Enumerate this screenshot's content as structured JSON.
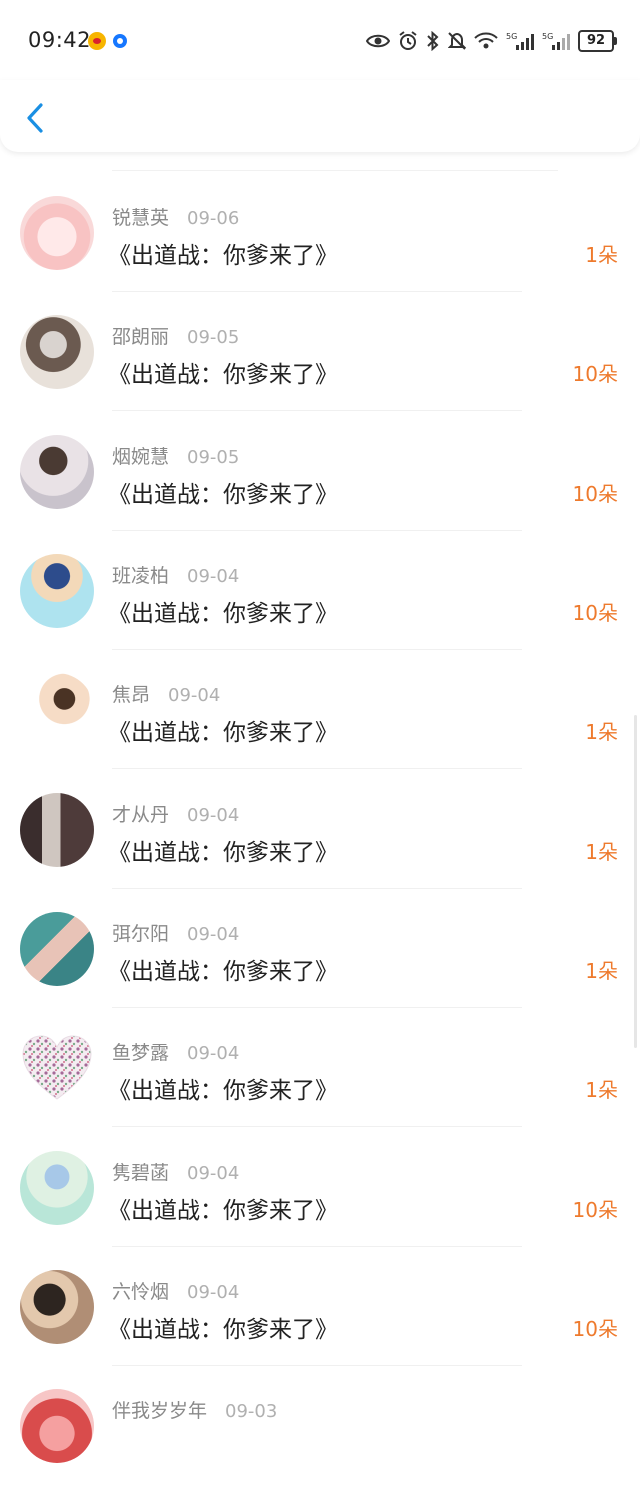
{
  "status_bar": {
    "time": "09:42",
    "battery": "92",
    "icons": [
      "weibo-icon",
      "app-notification-icon",
      "eye-icon",
      "alarm-icon",
      "bluetooth-icon",
      "mute-icon",
      "wifi-icon",
      "signal-5g-icon",
      "signal-5g-icon"
    ]
  },
  "header": {
    "back_icon": "chevron-left-icon"
  },
  "colors": {
    "accent": "#1a8fe3",
    "gift": "#ee7a2d",
    "name": "#8a8a8a",
    "date": "#b0b0b0"
  },
  "records": [
    {
      "name": "锐慧英",
      "date": "09-06",
      "title": "《出道战：你爹来了》",
      "gift": "1朵"
    },
    {
      "name": "邵朗丽",
      "date": "09-05",
      "title": "《出道战：你爹来了》",
      "gift": "10朵"
    },
    {
      "name": "烟婉慧",
      "date": "09-05",
      "title": "《出道战：你爹来了》",
      "gift": "10朵"
    },
    {
      "name": "班凌柏",
      "date": "09-04",
      "title": "《出道战：你爹来了》",
      "gift": "10朵"
    },
    {
      "name": "焦昂",
      "date": "09-04",
      "title": "《出道战：你爹来了》",
      "gift": "1朵"
    },
    {
      "name": "才从丹",
      "date": "09-04",
      "title": "《出道战：你爹来了》",
      "gift": "1朵"
    },
    {
      "name": "弭尔阳",
      "date": "09-04",
      "title": "《出道战：你爹来了》",
      "gift": "1朵"
    },
    {
      "name": "鱼梦露",
      "date": "09-04",
      "title": "《出道战：你爹来了》",
      "gift": "1朵"
    },
    {
      "name": "隽碧菡",
      "date": "09-04",
      "title": "《出道战：你爹来了》",
      "gift": "10朵"
    },
    {
      "name": "六怜烟",
      "date": "09-04",
      "title": "《出道战：你爹来了》",
      "gift": "10朵"
    },
    {
      "name": "伴我岁岁年",
      "date": "09-03",
      "title": "",
      "gift": ""
    }
  ]
}
